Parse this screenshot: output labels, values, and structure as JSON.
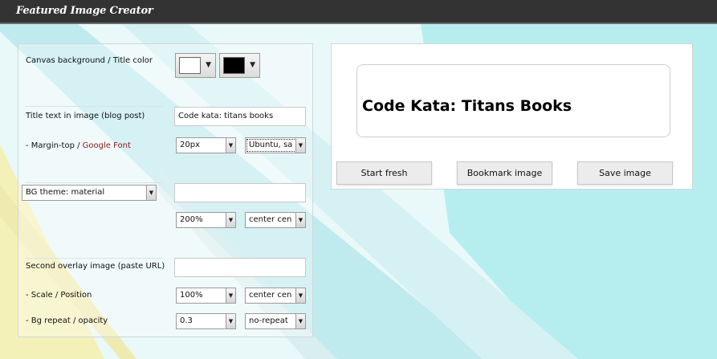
{
  "app": {
    "title": "Featured Image Creator"
  },
  "colors": {
    "canvas_background": "#ffffff",
    "title_color": "#000000",
    "accent_font_link": "#8b1a1a"
  },
  "form": {
    "canvas_row_label": "Canvas background / Title color",
    "title_row_label": "Title text in image (blog post)",
    "title_value": "Code kata: titans books",
    "margin_label_prefix": "- Margin-top / ",
    "margin_label_link": "Google Font",
    "margin_value": "20px",
    "font_value": "Ubuntu, sa",
    "bg_theme_value": "BG theme: material",
    "bg_url_value": "",
    "bg_scale_value": "200%",
    "bg_position_value": "center cen",
    "overlay_label": "Second overlay image (paste URL)",
    "overlay_url_value": "",
    "scale_position_label": "- Scale / Position",
    "overlay_scale_value": "100%",
    "overlay_position_value": "center cen",
    "repeat_opacity_label": "- Bg repeat / opacity",
    "opacity_value": "0.3",
    "repeat_value": "no-repeat"
  },
  "preview": {
    "title_text": "Code Kata: Titans Books",
    "buttons": {
      "start_fresh": "Start fresh",
      "bookmark": "Bookmark image",
      "save": "Save image"
    }
  },
  "icons": {
    "dropdown": "dropdown-arrow-icon"
  }
}
